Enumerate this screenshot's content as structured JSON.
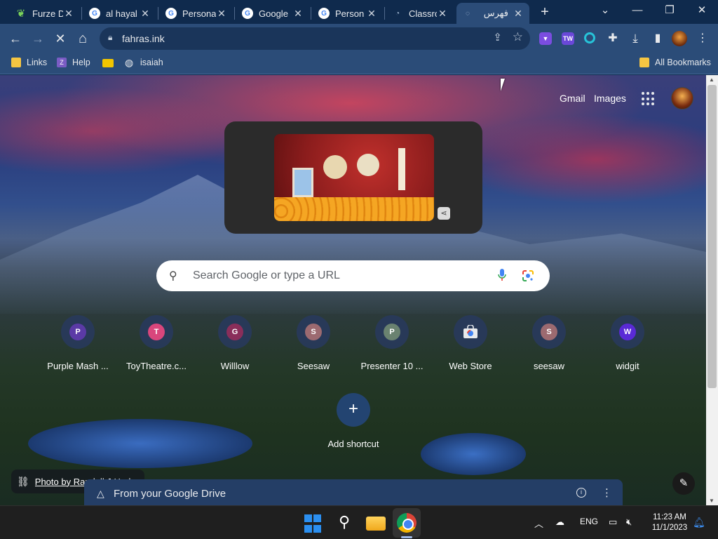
{
  "tabs": [
    {
      "title": "Furze D",
      "favicon": "leaf-icon"
    },
    {
      "title": "al hayal",
      "favicon": "google-icon"
    },
    {
      "title": "Persona",
      "favicon": "google-icon"
    },
    {
      "title": "Google",
      "favicon": "google-icon"
    },
    {
      "title": "Person",
      "favicon": "google-icon"
    },
    {
      "title": "Classro",
      "favicon": "classroom-icon"
    },
    {
      "title": "فهرس",
      "favicon": "loading-icon",
      "active": true
    }
  ],
  "window_controls": {
    "dropdown": "⌄",
    "minimize": "—",
    "restore": "❐",
    "close": "✕"
  },
  "toolbar": {
    "url": "fahras.ink",
    "back": "←",
    "forward": "→",
    "stop": "✕",
    "home": "⌂"
  },
  "bookmarks": {
    "items": [
      {
        "label": "Links",
        "icon": "folder-icon"
      },
      {
        "label": "Help",
        "icon": "help-icon"
      },
      {
        "label": "",
        "icon": "yellow-bookmark-icon"
      },
      {
        "label": "isaiah",
        "icon": "globe-icon"
      }
    ],
    "all_bookmarks": "All Bookmarks"
  },
  "ntp": {
    "gmail": "Gmail",
    "images": "Images",
    "search_placeholder": "Search Google or type a URL",
    "shortcuts": [
      {
        "label": "Purple Mash ...",
        "letter": "P",
        "color": "#5b3aa6"
      },
      {
        "label": "ToyTheatre.c...",
        "letter": "T",
        "color": "#d9467c"
      },
      {
        "label": "Willlow",
        "letter": "G",
        "color": "#8a2e5a"
      },
      {
        "label": "Seesaw",
        "letter": "S",
        "color": "#9c6a70"
      },
      {
        "label": "Presenter 10 ...",
        "letter": "P",
        "color": "#6a8270"
      },
      {
        "label": "Web Store",
        "letter": "",
        "color": "#ffffff"
      },
      {
        "label": "seesaw",
        "letter": "S",
        "color": "#9c6a70"
      },
      {
        "label": "widgit",
        "letter": "W",
        "color": "#5a2ad6"
      }
    ],
    "add_shortcut": "Add shortcut",
    "photo_credit": "Photo by Randall J Hod",
    "drive_title": "From your Google Drive"
  },
  "taskbar": {
    "language": "ENG",
    "time": "11:23 AM",
    "date": "11/1/2023"
  },
  "colors": {
    "tabstrip": "#0f2a4d",
    "toolbar": "#2b4c78",
    "accent_blue": "#2b8ff0"
  }
}
